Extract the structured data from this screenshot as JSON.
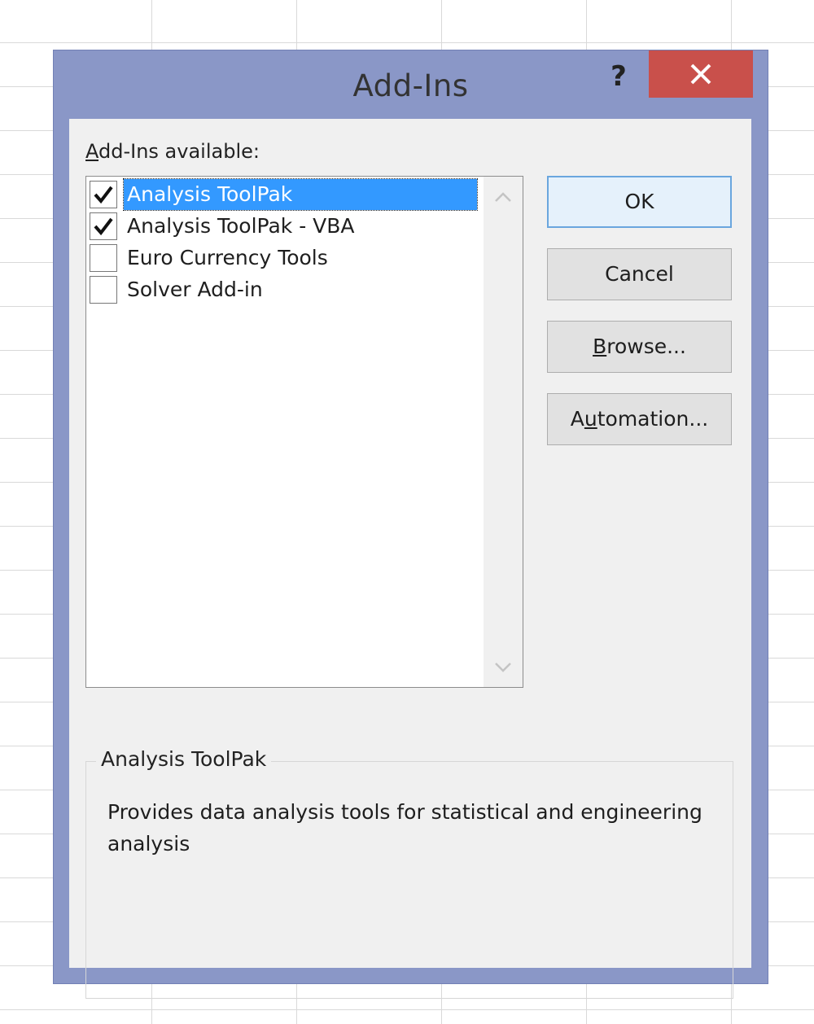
{
  "dialog": {
    "title": "Add-Ins",
    "help_icon": "help-icon",
    "close_icon": "close-icon",
    "available_label_accel": "A",
    "available_label_rest": "dd-Ins available:"
  },
  "addins": [
    {
      "label": "Analysis ToolPak",
      "checked": true,
      "selected": true
    },
    {
      "label": "Analysis ToolPak - VBA",
      "checked": true,
      "selected": false
    },
    {
      "label": "Euro Currency Tools",
      "checked": false,
      "selected": false
    },
    {
      "label": "Solver Add-in",
      "checked": false,
      "selected": false
    }
  ],
  "buttons": {
    "ok": "OK",
    "cancel": "Cancel",
    "browse_accel": "B",
    "browse_rest": "rowse...",
    "automation_pre": "A",
    "automation_accel": "u",
    "automation_rest": "tomation..."
  },
  "description": {
    "title": "Analysis ToolPak",
    "text": "Provides data analysis tools for statistical and engineering analysis"
  },
  "colors": {
    "frame": "#8a97c7",
    "close": "#c9504b",
    "selection": "#3399ff"
  }
}
